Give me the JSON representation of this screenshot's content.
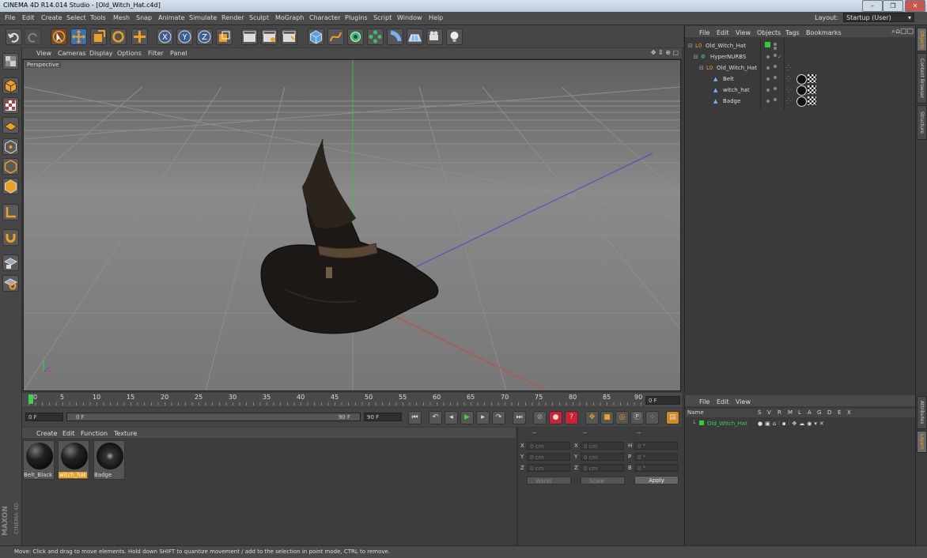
{
  "window": {
    "title": "CINEMA 4D R14.014 Studio - [Old_Witch_Hat.c4d]"
  },
  "menubar": {
    "items": [
      "File",
      "Edit",
      "Create",
      "Select",
      "Tools",
      "Mesh",
      "Snap",
      "Animate",
      "Simulate",
      "Render",
      "Sculpt",
      "MoGraph",
      "Character",
      "Plugins",
      "Script",
      "Window",
      "Help"
    ],
    "layout_label": "Layout:",
    "layout_value": "Startup (User)"
  },
  "viewport": {
    "menu": [
      "View",
      "Cameras",
      "Display",
      "Options",
      "Filter",
      "Panel"
    ],
    "label": "Perspective"
  },
  "timeline": {
    "ticks": [
      "0",
      "5",
      "10",
      "15",
      "20",
      "25",
      "30",
      "35",
      "40",
      "45",
      "50",
      "55",
      "60",
      "65",
      "70",
      "75",
      "80",
      "85",
      "90"
    ],
    "current_frame": "0 F",
    "start": "0 F",
    "slider_start": "0 F",
    "slider_end": "90 F",
    "end": "90 F"
  },
  "materials": {
    "menu": [
      "Create",
      "Edit",
      "Function",
      "Texture"
    ],
    "items": [
      {
        "label": "Belt_Black",
        "selected": false
      },
      {
        "label": "witch_hat",
        "selected": true
      },
      {
        "label": "Badge",
        "selected": false
      }
    ]
  },
  "coordinates": {
    "headers": [
      "--",
      "--",
      "--"
    ],
    "rows": [
      {
        "a": "X",
        "av": "0 cm",
        "b": "X",
        "bv": "0 cm",
        "c": "H",
        "cv": "0 °"
      },
      {
        "a": "Y",
        "av": "0 cm",
        "b": "Y",
        "bv": "0 cm",
        "c": "P",
        "cv": "0 °"
      },
      {
        "a": "Z",
        "av": "0 cm",
        "b": "Z",
        "bv": "0 cm",
        "c": "B",
        "cv": "0 °"
      }
    ],
    "mode": "World",
    "scale": "Scale",
    "apply": "Apply"
  },
  "objects": {
    "menu": [
      "File",
      "Edit",
      "View",
      "Objects",
      "Tags",
      "Bookmarks"
    ],
    "tree": [
      {
        "name": "Old_Witch_Hat",
        "level": 0
      },
      {
        "name": "HyperNURBS",
        "level": 1
      },
      {
        "name": "Old_Witch_Hat",
        "level": 2
      },
      {
        "name": "Belt",
        "level": 3
      },
      {
        "name": "witch_hat",
        "level": 3
      },
      {
        "name": "Badge",
        "level": 3
      }
    ]
  },
  "layers": {
    "menu": [
      "File",
      "Edit",
      "View"
    ],
    "columns": [
      "Name",
      "S",
      "V",
      "R",
      "M",
      "L",
      "A",
      "G",
      "D",
      "E",
      "X"
    ],
    "rows": [
      {
        "name": "Old_Witch_Hat"
      }
    ]
  },
  "right_tabs": [
    "Objects",
    "Content Browser",
    "Structure",
    "Attributes",
    "Layers"
  ],
  "branding": {
    "maxon": "MAXON",
    "product": "CINEMA 4D"
  },
  "status": "Move: Click and drag to move elements. Hold down SHIFT to quantize movement / add to the selection in point mode, CTRL to remove.",
  "colors": {
    "accent_orange": "#f0a020",
    "select_blue": "#4a90d9",
    "green_tag": "#2fcf2f"
  }
}
